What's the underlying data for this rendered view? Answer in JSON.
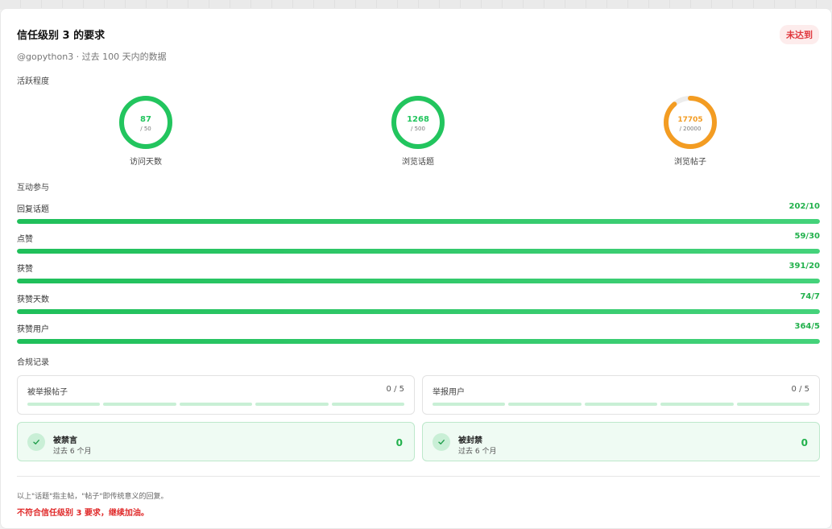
{
  "header": {
    "title": "信任级别 3 的要求",
    "status_badge": "未达到",
    "subtitle": "@gopython3 · 过去 100 天内的数据"
  },
  "activity": {
    "section_label": "活跃程度",
    "rings": [
      {
        "value": "87",
        "target": "/ 50",
        "label": "访问天数",
        "progress": 1.0,
        "color": "#22c55e"
      },
      {
        "value": "1268",
        "target": "/ 500",
        "label": "浏览话题",
        "progress": 1.0,
        "color": "#22c55e"
      },
      {
        "value": "17705",
        "target": "/ 20000",
        "label": "浏览帖子",
        "progress": 0.885,
        "color": "#f39c22"
      }
    ]
  },
  "engagement": {
    "section_label": "互动参与",
    "bars": [
      {
        "label": "回复话题",
        "value": "202/10",
        "progress": 1.0
      },
      {
        "label": "点赞",
        "value": "59/30",
        "progress": 1.0
      },
      {
        "label": "获赞",
        "value": "391/20",
        "progress": 1.0
      },
      {
        "label": "获赞天数",
        "value": "74/7",
        "progress": 1.0
      },
      {
        "label": "获赞用户",
        "value": "364/5",
        "progress": 1.0
      }
    ]
  },
  "compliance": {
    "section_label": "合规记录",
    "reported_posts": {
      "label": "被举报帖子",
      "count": "0 / 5"
    },
    "reporting_users": {
      "label": "举报用户",
      "count": "0 / 5"
    },
    "silenced": {
      "title": "被禁言",
      "sub": "过去 6 个月",
      "value": "0"
    },
    "suspended": {
      "title": "被封禁",
      "sub": "过去 6 个月",
      "value": "0"
    }
  },
  "footer": {
    "note": "以上\"话题\"指主帖，\"帖子\"即传统意义的回复。",
    "result": "不符合信任级别 3 要求，继续加油。"
  },
  "colors": {
    "success": "#22b14c",
    "warning": "#f39c22",
    "danger": "#e02a2a"
  }
}
